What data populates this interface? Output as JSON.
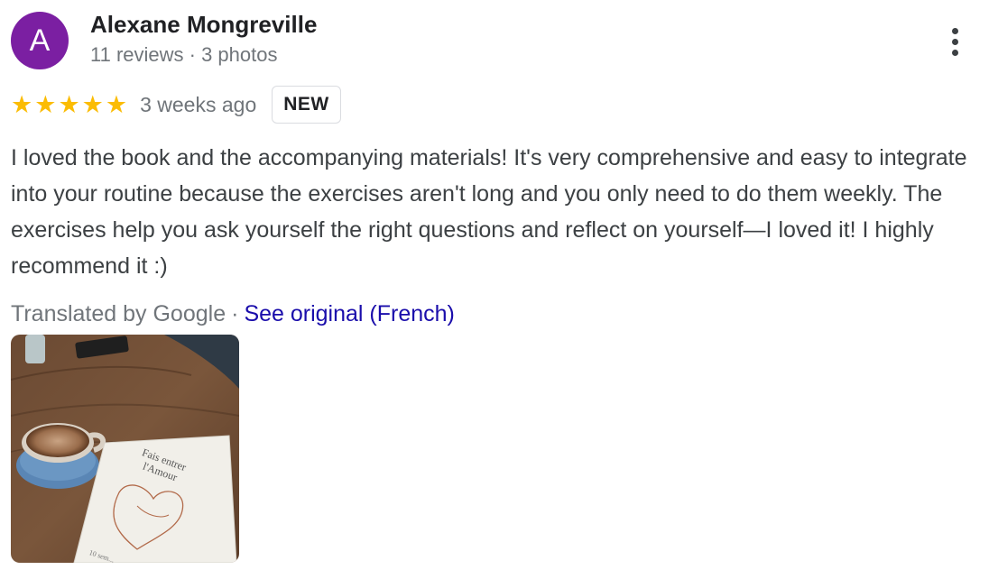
{
  "author": {
    "initial": "A",
    "name": "Alexane Mongreville",
    "meta": "11 reviews · 3 photos",
    "avatar_color": "#7b1fa2"
  },
  "review": {
    "rating": 5,
    "rating_max": 5,
    "time": "3 weeks ago",
    "badge": "NEW",
    "text": "I loved the book and the accompanying materials! It's very comprehensive and easy to integrate into your routine because the exercises aren't long and you only need to do them weekly. The exercises help you ask yourself the right questions and reflect on yourself—I loved it! I highly recommend it :)",
    "translated_by": "Translated by Google",
    "separator": "·",
    "see_original": "See original (French)"
  },
  "photo": {
    "book_title_line1": "Fais entrer",
    "book_title_line2": "l'Amour",
    "book_footer": "10 sem..."
  },
  "colors": {
    "star": "#fbbc04",
    "link": "#1a0dab",
    "secondary_text": "#70757a"
  },
  "icons": {
    "more": "more-vert-icon",
    "star": "star-icon"
  }
}
